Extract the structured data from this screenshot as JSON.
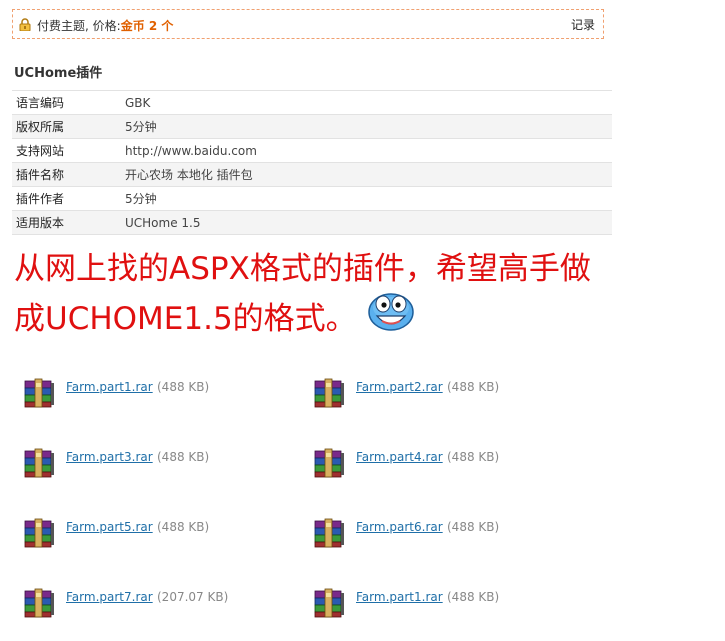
{
  "paid_notice": {
    "text": "付费主题, 价格:",
    "price": "金币  2 个",
    "record_label": "记录"
  },
  "plugin": {
    "title": "UCHome插件",
    "rows": [
      {
        "key": "语言编码",
        "value": "GBK"
      },
      {
        "key": "版权所属",
        "value": "5分钟"
      },
      {
        "key": "支持网站",
        "value": "http://www.baidu.com"
      },
      {
        "key": "插件名称",
        "value": "开心农场 本地化 插件包"
      },
      {
        "key": "插件作者",
        "value": "5分钟"
      },
      {
        "key": "适用版本",
        "value": "UCHome 1.5"
      }
    ]
  },
  "message": {
    "line1": "从网上找的ASPX格式的插件，希望高手做",
    "line2": "成UCHOME1.5的格式。",
    "color": "#e01010"
  },
  "attachments": [
    {
      "name": "Farm.part1.rar",
      "size": "(488 KB)"
    },
    {
      "name": "Farm.part2.rar",
      "size": "(488 KB)"
    },
    {
      "name": "Farm.part3.rar",
      "size": "(488 KB)"
    },
    {
      "name": "Farm.part4.rar",
      "size": "(488 KB)"
    },
    {
      "name": "Farm.part5.rar",
      "size": "(488 KB)"
    },
    {
      "name": "Farm.part6.rar",
      "size": "(488 KB)"
    },
    {
      "name": "Farm.part7.rar",
      "size": "(207.07 KB)"
    },
    {
      "name": "Farm.part1.rar",
      "size": "(488 KB)"
    }
  ],
  "icons": {
    "lock": "lock-icon",
    "smiley": "smiley-emoticon-icon",
    "archive": "rar-archive-icon"
  }
}
